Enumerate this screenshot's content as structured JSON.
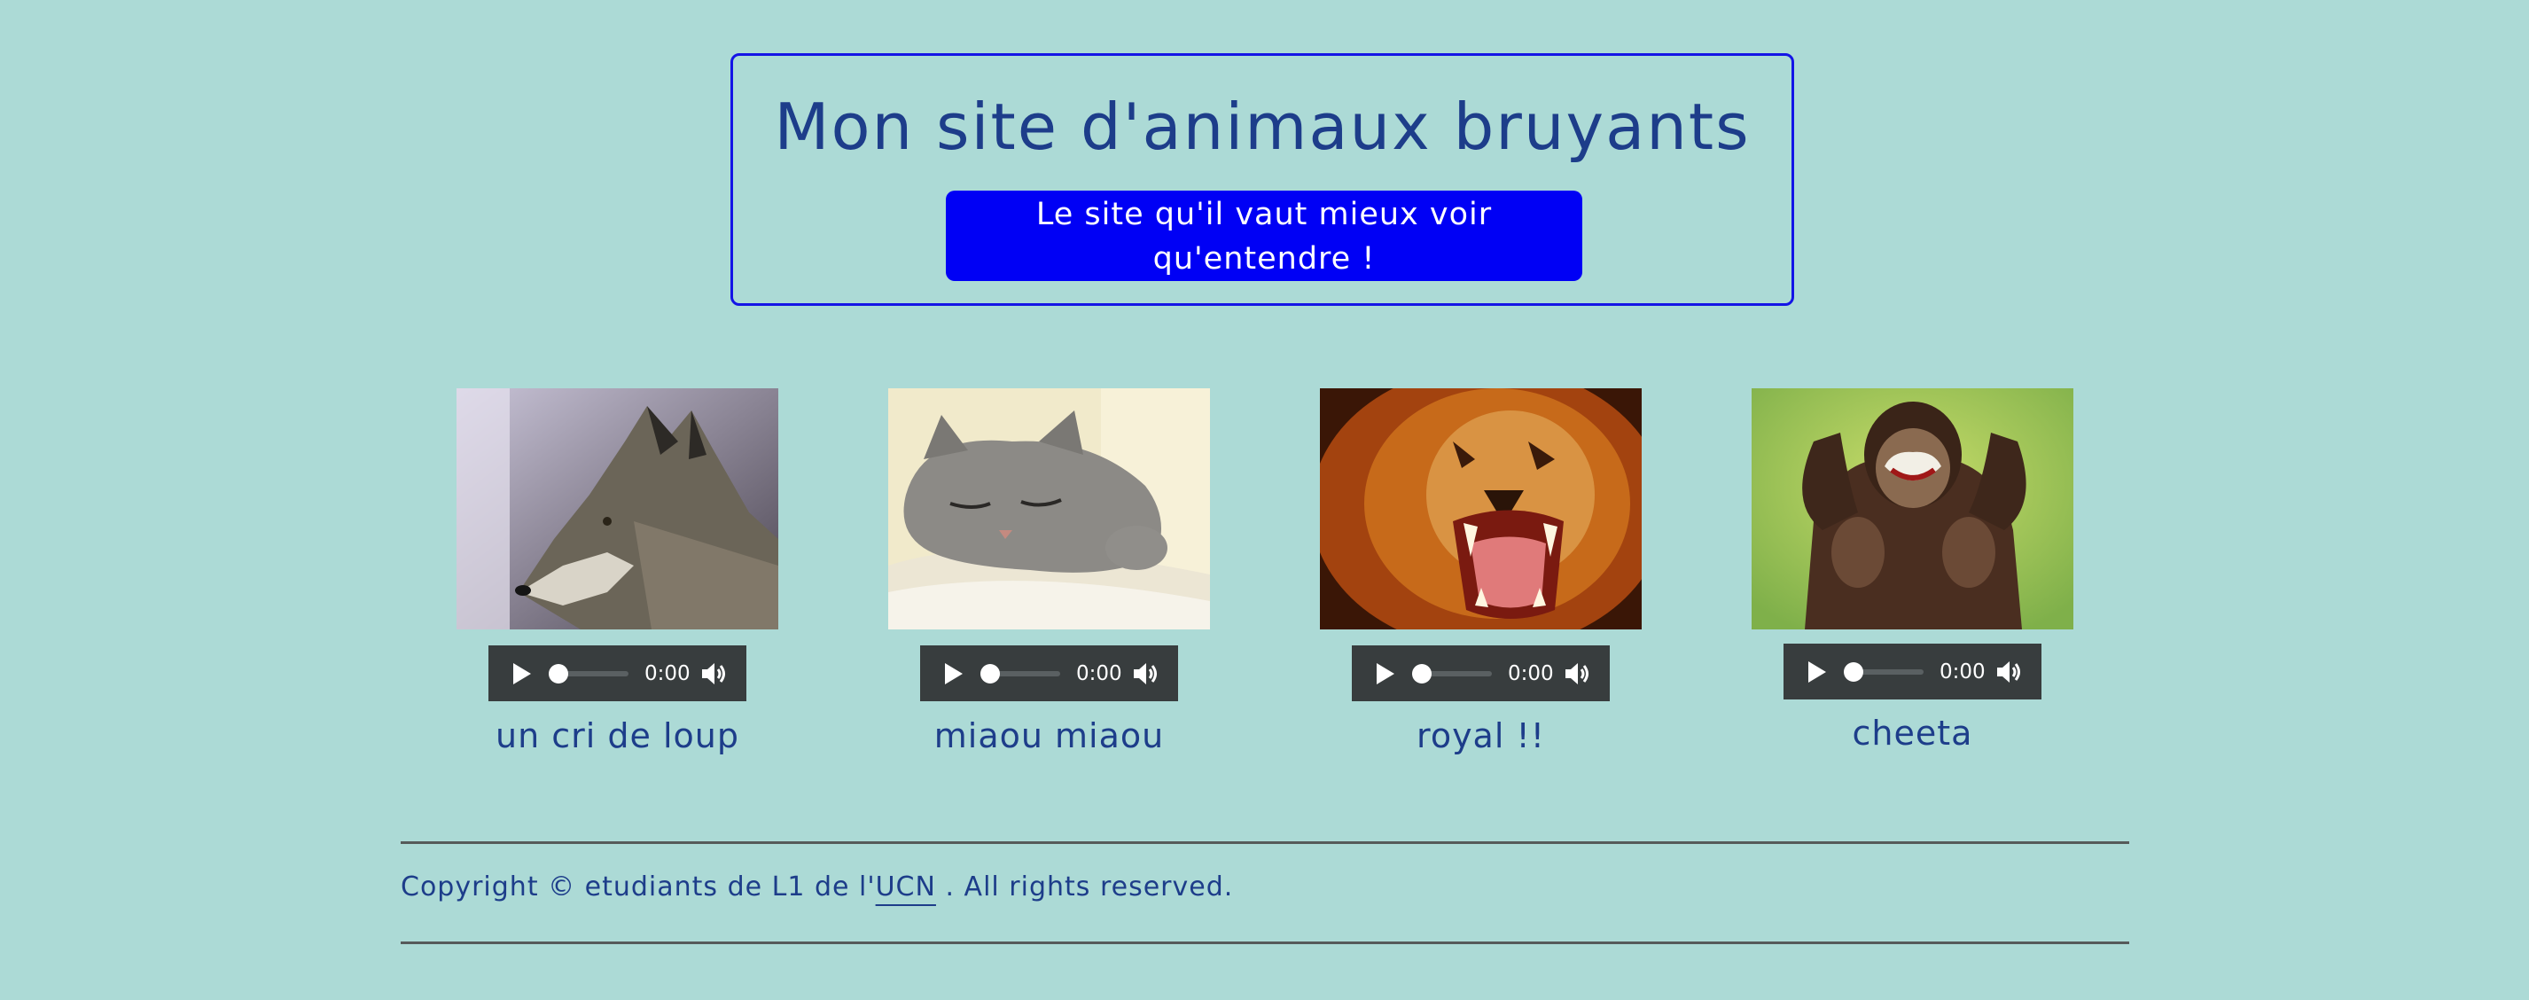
{
  "header": {
    "title": "Mon site d'animaux bruyants",
    "subtitle_line1": "Le site qu'il vaut mieux voir",
    "subtitle_line2": "qu'entendre !"
  },
  "colors": {
    "background": "#acdad6",
    "accent_blue": "#0000f5",
    "border_blue": "#1414e6",
    "text": "#1d3d8a",
    "player_bg": "#383d3e"
  },
  "animals": [
    {
      "caption": "un cri de loup",
      "time": "0:00",
      "icon": "wolf-photo"
    },
    {
      "caption": "miaou miaou",
      "time": "0:00",
      "icon": "kitten-photo"
    },
    {
      "caption": "royal !!",
      "time": "0:00",
      "icon": "lion-photo"
    },
    {
      "caption": "cheeta",
      "time": "0:00",
      "icon": "chimpanzee-photo"
    }
  ],
  "footer": {
    "prefix": "Copyright © etudiants de L1 de l'",
    "link": "UCN",
    "suffix": " . All rights reserved."
  }
}
